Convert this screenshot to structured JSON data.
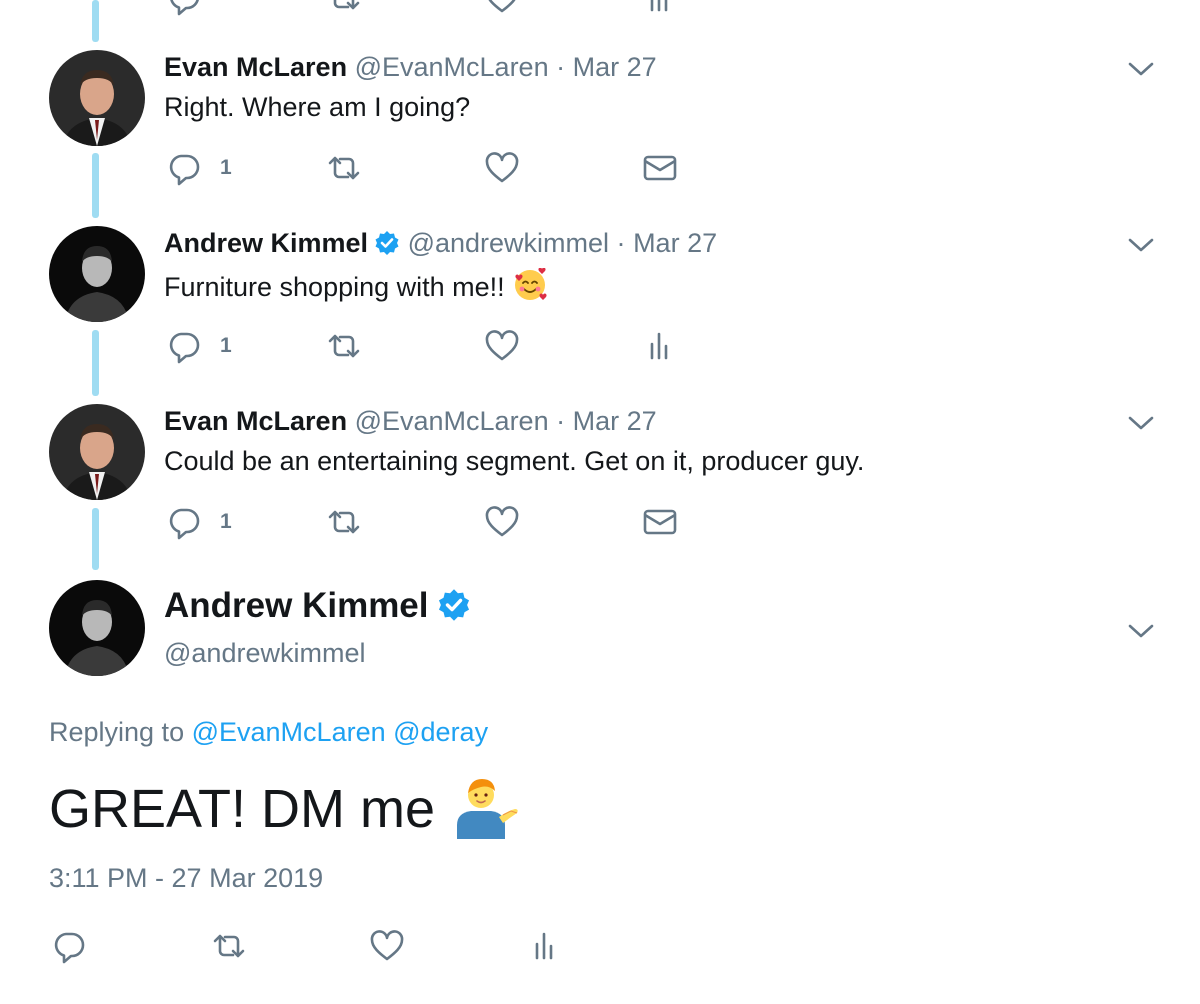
{
  "icons": {
    "reply": "reply-icon",
    "retweet": "retweet-icon",
    "like": "heart-icon",
    "dm": "envelope-icon",
    "analytics": "analytics-icon",
    "caret": "chevron-down-icon",
    "verified": "verified-badge-icon"
  },
  "colors": {
    "text": "#14171a",
    "secondary": "#657786",
    "link": "#1da1f2",
    "thread_line": "#9fdcf2",
    "verified": "#1da1f2"
  },
  "tweets": [
    {
      "name": "Evan McLaren",
      "handle": "@EvanMcLaren",
      "separator": "·",
      "date": "Mar 27",
      "text": "Right. Where am I going?",
      "reply_count": "1"
    },
    {
      "name": "Andrew Kimmel",
      "handle": "@andrewkimmel",
      "separator": "·",
      "date": "Mar 27",
      "text": "Furniture shopping with me!!",
      "emoji": "smiling-face-with-hearts",
      "reply_count": "1"
    },
    {
      "name": "Evan McLaren",
      "handle": "@EvanMcLaren",
      "separator": "·",
      "date": "Mar 27",
      "text": "Could be an entertaining segment. Get on it, producer guy.",
      "reply_count": "1"
    }
  ],
  "main_tweet": {
    "name": "Andrew Kimmel",
    "handle": "@andrewkimmel",
    "replying_prefix": "Replying to",
    "replying_to": [
      "@EvanMcLaren",
      "@deray"
    ],
    "text": "GREAT! DM me",
    "emoji": "person-tipping-hand",
    "timestamp": "3:11 PM - 27 Mar 2019"
  }
}
